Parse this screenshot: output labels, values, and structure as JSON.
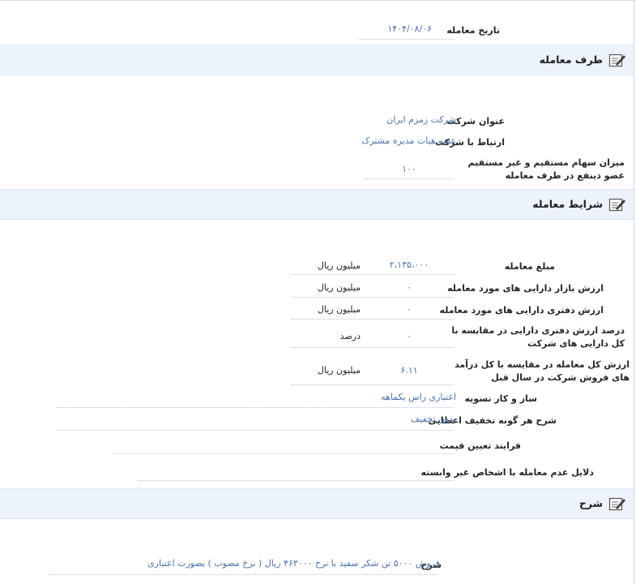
{
  "top": {
    "date_label": "تاریخ معامله",
    "date_value": "۱۴۰۴/۰۸/۰۶"
  },
  "counterparty": {
    "title": "طرف معامله",
    "icon": "edit-note-icon",
    "company_label": "عنوان شرکت",
    "company_value": "شرکت زمزم ایران",
    "relation_label": "ارتباط با شرکت",
    "relation_value": "عضو هیات مدیره مشترک",
    "share_label": "میزان سهام مستقیم و غیر مستقیم عضو ذینفع در طرف معامله",
    "share_value": "۱۰۰"
  },
  "terms": {
    "title": "شرایط معامله",
    "icon": "edit-note-icon",
    "rows": [
      {
        "label": "مبلغ معامله",
        "value": "۲،۱۳۵،۰۰۰",
        "unit": "میلیون ریال"
      },
      {
        "label": "ارزش بازار دارایی های مورد معامله",
        "value": "۰",
        "unit": "میلیون ریال"
      },
      {
        "label": "ارزش دفتری دارایی های مورد معامله",
        "value": "۰",
        "unit": "میلیون ریال"
      },
      {
        "label": "درصد ارزش دفتری دارایی در مقایسه با کل دارایی های شرکت",
        "value": "۰",
        "unit": "درصد"
      },
      {
        "label": "ارزش کل معامله در مقایسه با کل درآمد های فروش شرکت در سال قبل",
        "value": "۶.۱۱",
        "unit": "میلیون ریال"
      }
    ],
    "settlement_label": "ساز و کار تسویه",
    "settlement_value": "اعتباری راس یکماهه",
    "discount_label": "شرح هر گونه تخفیف اعطایی",
    "discount_value": "بدون تخفیف",
    "pricing_label": "فرایند تعیین قیمت",
    "pricing_value": "",
    "reasons_label": "دلایل عدم معامله با اشخاص غیر وابسته",
    "reasons_value": ""
  },
  "description": {
    "title": "شرح",
    "icon": "edit-note-icon",
    "label": "شرح",
    "value": "فروش ۵۰۰۰ تن شکر سفید با نرخ ۴۶۳۰۰۰ ریال ( نرخ مصوب ) بصورت اعتباری"
  }
}
